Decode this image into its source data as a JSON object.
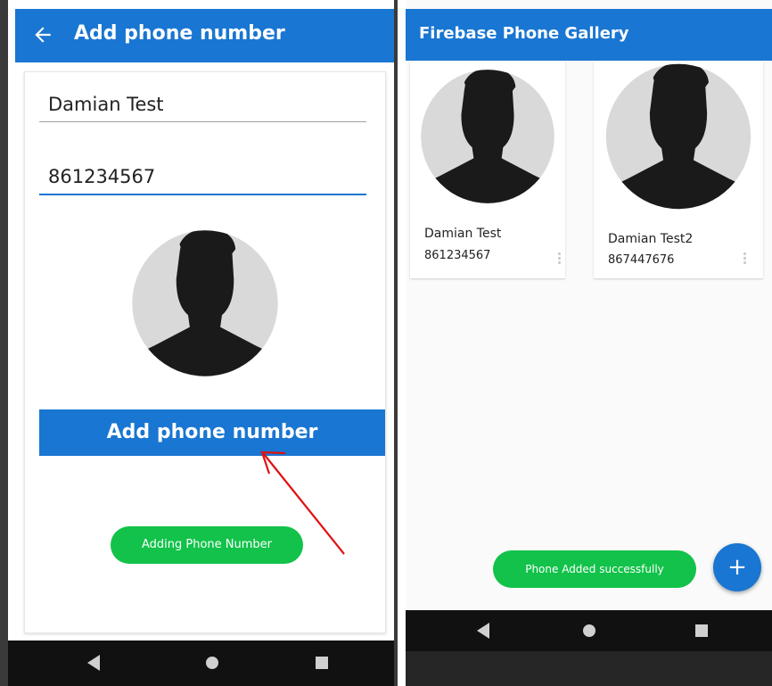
{
  "left_screen": {
    "appbar": {
      "title": "Add phone number",
      "back_icon": "arrow-left-icon"
    },
    "form": {
      "name_value": "Damian Test",
      "phone_value": "861234567",
      "avatar_icon": "person-silhouette-icon",
      "submit_label": "Add phone number"
    },
    "toast": "Adding Phone Number",
    "nav": {
      "back_icon": "nav-back-icon",
      "home_icon": "nav-home-icon",
      "recent_icon": "nav-recent-icon"
    }
  },
  "right_screen": {
    "appbar": {
      "title": "Firebase Phone Gallery"
    },
    "gallery": [
      {
        "name": "Damian Test",
        "phone": "861234567",
        "avatar_icon": "person-silhouette-icon",
        "menu_icon": "more-vert-icon"
      },
      {
        "name": "Damian Test2",
        "phone": "867447676",
        "avatar_icon": "person-silhouette-icon",
        "menu_icon": "more-vert-icon"
      }
    ],
    "toast": "Phone Added successfully",
    "fab": {
      "label": "+",
      "icon": "add-icon"
    },
    "nav": {
      "back_icon": "nav-back-icon",
      "home_icon": "nav-home-icon",
      "recent_icon": "nav-recent-icon"
    }
  },
  "colors": {
    "primary": "#1976d2",
    "toast_green": "#12c24a",
    "annotation_red": "#e01010",
    "nav_bar": "#111111"
  }
}
